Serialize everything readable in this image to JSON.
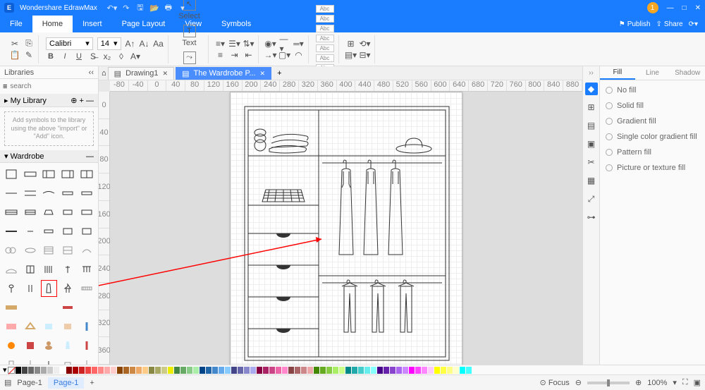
{
  "app": {
    "title": "Wondershare EdrawMax",
    "user_badge": "1"
  },
  "menu": {
    "file": "File",
    "home": "Home",
    "insert": "Insert",
    "pagelayout": "Page Layout",
    "view": "View",
    "symbols": "Symbols",
    "publish": "Publish",
    "share": "Share"
  },
  "ribbon": {
    "font": "Calibri",
    "size": "14",
    "select": "Select",
    "text": "Text",
    "connector": "Connector",
    "shape": "Shape",
    "stylebox": "Abc"
  },
  "left": {
    "libraries": "Libraries",
    "search_ph": "search",
    "mylib": "My Library",
    "hint": "Add symbols to the library using the above \"import\" or \"Add\" icon.",
    "wardrobe": "Wardrobe"
  },
  "doctabs": {
    "d1": "Drawing1",
    "d2": "The Wardrobe P..."
  },
  "right": {
    "fill": "Fill",
    "line": "Line",
    "shadow": "Shadow",
    "nofill": "No fill",
    "solid": "Solid fill",
    "gradient": "Gradient fill",
    "single": "Single color gradient fill",
    "pattern": "Pattern fill",
    "picture": "Picture or texture fill"
  },
  "status": {
    "page": "Page-1",
    "page2": "Page-1",
    "focus": "Focus",
    "zoom": "100%"
  },
  "ruler_h": [
    "-80",
    "-40",
    "0",
    "40",
    "80",
    "120",
    "160",
    "200",
    "240",
    "280",
    "320",
    "360",
    "400",
    "440",
    "480",
    "520",
    "560",
    "600",
    "640",
    "680",
    "720",
    "760",
    "800",
    "840",
    "880"
  ],
  "ruler_v": [
    "0",
    "40",
    "80",
    "120",
    "160",
    "200",
    "240",
    "280",
    "320",
    "360"
  ],
  "colors": [
    "#000",
    "#444",
    "#666",
    "#888",
    "#aaa",
    "#ccc",
    "#eee",
    "#fff",
    "#800",
    "#a00",
    "#c22",
    "#e44",
    "#f66",
    "#f88",
    "#faa",
    "#fcc",
    "#840",
    "#a62",
    "#c84",
    "#ea6",
    "#fc8",
    "#884",
    "#aa6",
    "#cc8",
    "#ee0",
    "#484",
    "#6a6",
    "#8c8",
    "#aea",
    "#048",
    "#26a",
    "#48c",
    "#6ae",
    "#8cf",
    "#448",
    "#66a",
    "#88c",
    "#aae",
    "#804",
    "#a26",
    "#c48",
    "#e6a",
    "#f8c",
    "#844",
    "#a66",
    "#c88",
    "#eaa",
    "#480",
    "#6a2",
    "#8c4",
    "#ae6",
    "#cf8",
    "#088",
    "#2aa",
    "#4cc",
    "#6ee",
    "#8ff",
    "#408",
    "#62a",
    "#84c",
    "#a6e",
    "#c8f",
    "#f0f",
    "#f4f",
    "#f8f",
    "#fcf",
    "#ff0",
    "#ff4",
    "#ff8",
    "#ffc",
    "#0ff",
    "#4ff"
  ]
}
